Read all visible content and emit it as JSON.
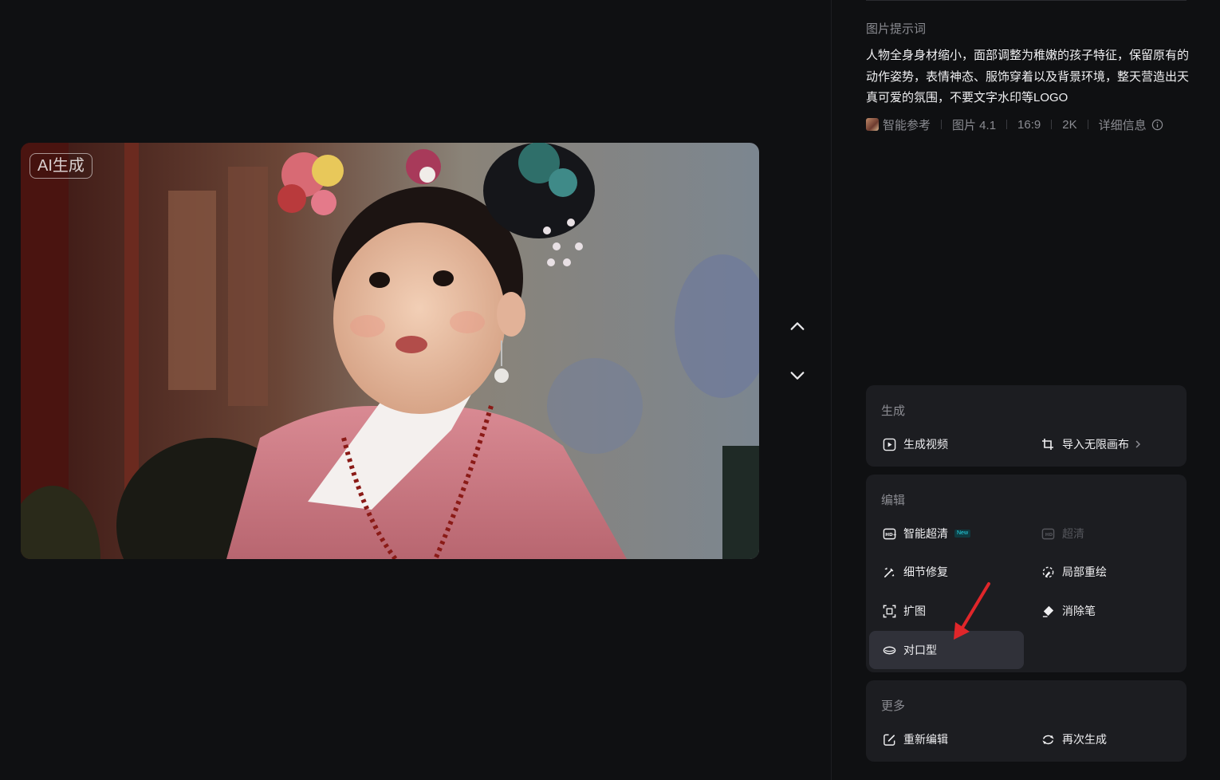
{
  "image": {
    "badge": "AI生成"
  },
  "navigation": {
    "up_icon": "chevron-up-icon",
    "down_icon": "chevron-down-icon"
  },
  "prompt": {
    "label": "图片提示词",
    "text": "人物全身身材缩小，面部调整为稚嫩的孩子特征，保留原有的动作姿势，表情神态、服饰穿着以及背景环境，整天营造出天真可爱的氛围，不要文字水印等LOGO"
  },
  "meta": {
    "reference": "智能参考",
    "model": "图片 4.1",
    "ratio": "16:9",
    "resolution": "2K",
    "details": "详细信息"
  },
  "generate_section": {
    "title": "生成",
    "items": [
      {
        "label": "生成视频",
        "icon": "play-video-icon"
      },
      {
        "label": "导入无限画布",
        "icon": "crop-canvas-icon"
      }
    ]
  },
  "edit_section": {
    "title": "编辑",
    "items": [
      {
        "label": "智能超清",
        "icon": "hd-plus-icon",
        "badge": "New"
      },
      {
        "label": "超清",
        "icon": "hd-icon",
        "disabled": true
      },
      {
        "label": "细节修复",
        "icon": "magic-wand-icon"
      },
      {
        "label": "局部重绘",
        "icon": "partial-redraw-icon"
      },
      {
        "label": "扩图",
        "icon": "expand-icon"
      },
      {
        "label": "消除笔",
        "icon": "eraser-icon"
      },
      {
        "label": "对口型",
        "icon": "lips-icon",
        "selected": true
      }
    ]
  },
  "more_section": {
    "title": "更多",
    "items": [
      {
        "label": "重新编辑",
        "icon": "edit-icon"
      },
      {
        "label": "再次生成",
        "icon": "regenerate-icon"
      }
    ]
  },
  "colors": {
    "background": "#0f1012",
    "card": "#1c1d21",
    "selected": "#303139",
    "annotation_arrow": "#e0262a",
    "new_badge": "#26d6e6"
  }
}
